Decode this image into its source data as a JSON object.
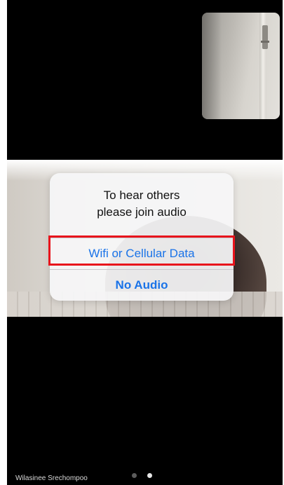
{
  "dialog": {
    "title": "To hear others\nplease join audio",
    "wifi_option": "Wifi or Cellular Data",
    "no_audio_option": "No Audio"
  },
  "participant": {
    "name": "Wilasinee Srechompoo"
  },
  "pager": {
    "current_page": 2,
    "total_pages": 2
  },
  "colors": {
    "accent": "#1a73e8",
    "highlight": "#e8141c",
    "background": "#000000"
  }
}
